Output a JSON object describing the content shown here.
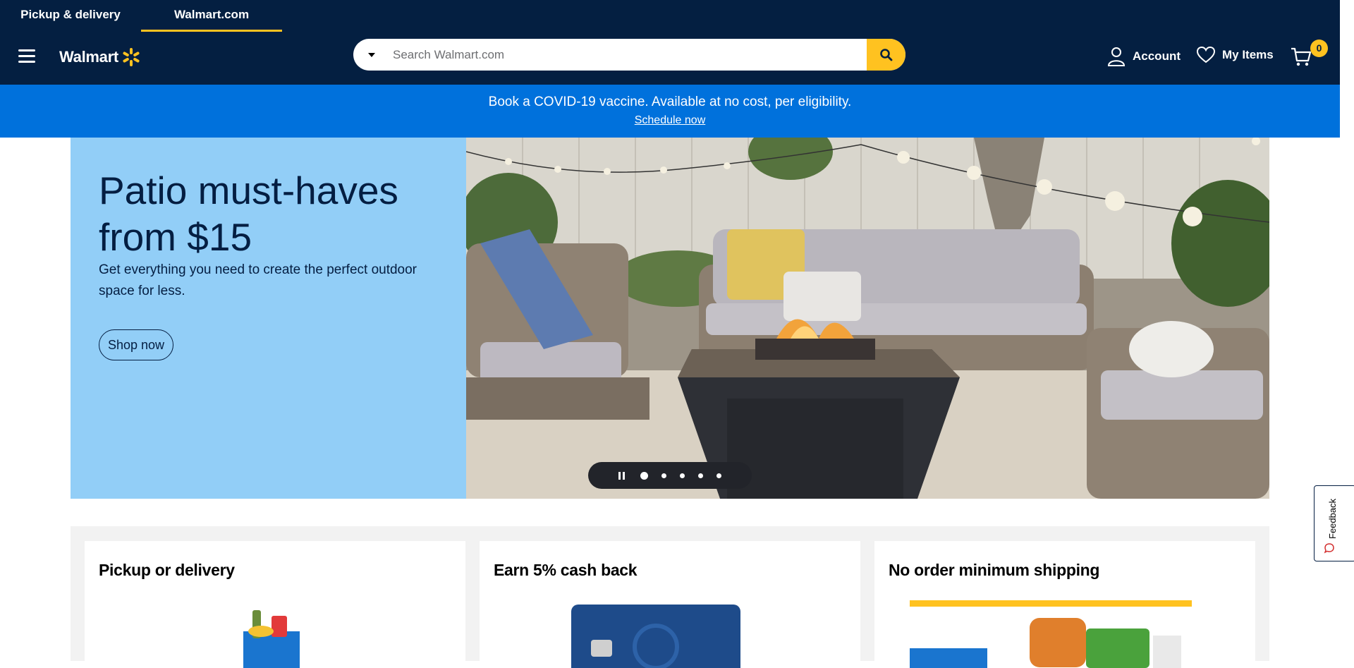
{
  "header": {
    "tabs": [
      {
        "label": "Pickup & delivery",
        "active": false
      },
      {
        "label": "Walmart.com",
        "active": true
      }
    ],
    "logo_text": "Walmart",
    "search": {
      "placeholder": "Search Walmart.com",
      "value": ""
    },
    "account_label": "Account",
    "my_items_label": "My Items",
    "cart_count": "0"
  },
  "banner": {
    "text": "Book a COVID-19 vaccine. Available at no cost, per eligibility.",
    "link": "Schedule now",
    "color": "#0071dc"
  },
  "hero": {
    "title": "Patio must-haves from $15",
    "subtitle": "Get everything you need to create the perfect outdoor space for less.",
    "button": "Shop now",
    "slides_count": 5,
    "active_slide": 1
  },
  "promos": [
    {
      "title": "Pickup or delivery"
    },
    {
      "title": "Earn 5% cash back"
    },
    {
      "title": "No order minimum shipping"
    }
  ],
  "feedback_label": "Feedback",
  "colors": {
    "navy": "#041f41",
    "yellow": "#ffc220",
    "blue": "#0071dc",
    "hero_bg": "#92cef7"
  }
}
